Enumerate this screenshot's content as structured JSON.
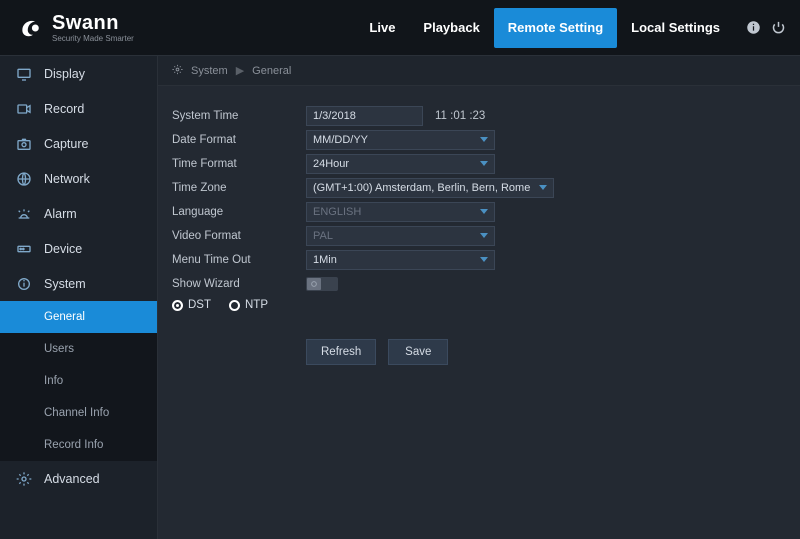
{
  "brand": {
    "name": "Swann",
    "tagline": "Security Made Smarter"
  },
  "nav": {
    "live": "Live",
    "playback": "Playback",
    "remote_setting": "Remote Setting",
    "local_settings": "Local Settings"
  },
  "sidebar": {
    "display": "Display",
    "record": "Record",
    "capture": "Capture",
    "network": "Network",
    "alarm": "Alarm",
    "device": "Device",
    "system": "System",
    "system_children": {
      "general": "General",
      "users": "Users",
      "info": "Info",
      "channel_info": "Channel Info",
      "record_info": "Record Info"
    },
    "advanced": "Advanced"
  },
  "breadcrumb": {
    "root": "System",
    "leaf": "General"
  },
  "form": {
    "labels": {
      "system_time": "System Time",
      "date_format": "Date Format",
      "time_format": "Time Format",
      "time_zone": "Time Zone",
      "language": "Language",
      "video_format": "Video Format",
      "menu_time_out": "Menu Time Out",
      "show_wizard": "Show Wizard"
    },
    "values": {
      "system_date": "1/3/2018",
      "system_clock": "11 :01 :23",
      "date_format": "MM/DD/YY",
      "time_format": "24Hour",
      "time_zone": "(GMT+1:00) Amsterdam, Berlin, Bern, Rome",
      "language": "ENGLISH",
      "video_format": "PAL",
      "menu_time_out": "1Min"
    },
    "radios": {
      "dst": "DST",
      "ntp": "NTP"
    }
  },
  "buttons": {
    "refresh": "Refresh",
    "save": "Save"
  }
}
